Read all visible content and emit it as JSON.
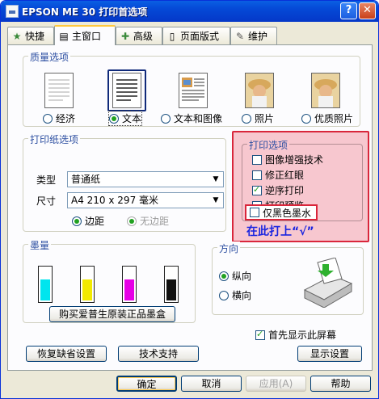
{
  "window": {
    "title": "EPSON ME 30 打印首选项",
    "help_label": "?",
    "close_label": "✕"
  },
  "tabs": [
    {
      "label": "快捷",
      "icon": "star-icon"
    },
    {
      "label": "主窗口",
      "icon": "printer-icon"
    },
    {
      "label": "高级",
      "icon": "settings-icon"
    },
    {
      "label": "页面版式",
      "icon": "page-icon"
    },
    {
      "label": "维护",
      "icon": "wrench-icon"
    }
  ],
  "quality": {
    "title": "质量选项",
    "options": [
      {
        "label": "经济",
        "selected": false
      },
      {
        "label": "文本",
        "selected": true
      },
      {
        "label": "文本和图像",
        "selected": false
      },
      {
        "label": "照片",
        "selected": false
      },
      {
        "label": "优质照片",
        "selected": false
      }
    ]
  },
  "paper": {
    "title": "打印纸选项",
    "type_label": "类型",
    "type_value": "普通纸",
    "size_label": "尺寸",
    "size_value": "A4 210 x 297 毫米",
    "border_label": "边距",
    "borderless_label": "无边距"
  },
  "print_options": {
    "title": "打印选项",
    "items": [
      {
        "label": "图像增强技术",
        "checked": false
      },
      {
        "label": "修正红眼",
        "checked": false
      },
      {
        "label": "逆序打印",
        "checked": true
      },
      {
        "label": "打印预览",
        "checked": false
      },
      {
        "label": "仅黑色墨水",
        "checked": false
      }
    ],
    "annotation": "在此打上“√”"
  },
  "ink": {
    "title": "墨量",
    "buy_label": "购买爱普生原装正品墨盒",
    "colors": [
      "#00e5ee",
      "#f2ea00",
      "#e600e6",
      "#111111"
    ],
    "levels": [
      0.6,
      0.6,
      0.6,
      0.6
    ]
  },
  "orientation": {
    "title": "方向",
    "portrait": "纵向",
    "landscape": "横向"
  },
  "show_first": {
    "label": "首先显示此屏幕",
    "checked": true
  },
  "buttons": {
    "restore": "恢复缺省设置",
    "support": "技术支持",
    "display": "显示设置",
    "ok": "确定",
    "cancel": "取消",
    "apply": "应用(A)",
    "help": "帮助"
  }
}
